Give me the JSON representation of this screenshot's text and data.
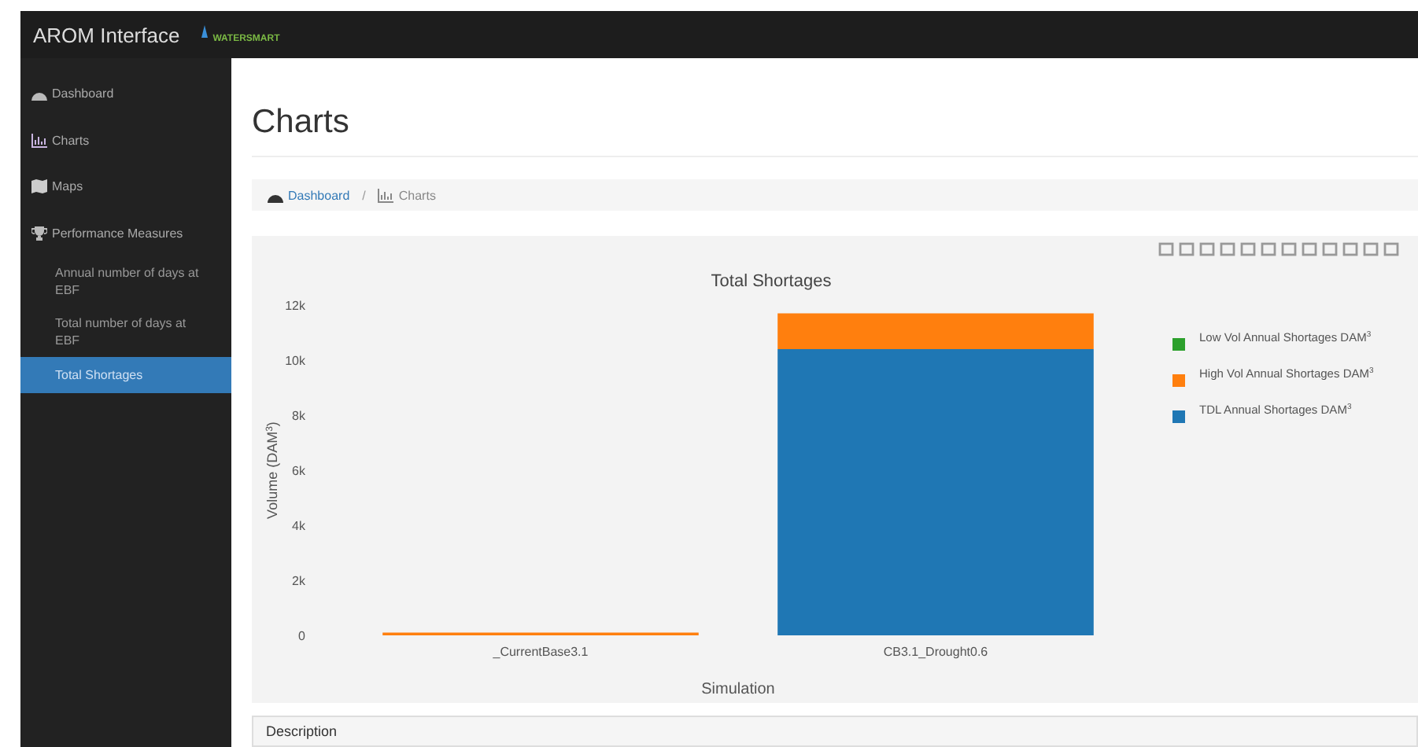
{
  "header": {
    "title": "AROM Interface",
    "logo_text": "WATERSMART"
  },
  "sidebar": {
    "items": [
      {
        "label": "Dashboard",
        "selected": false
      },
      {
        "label": "Charts",
        "selected": false
      },
      {
        "label": "Maps",
        "selected": false
      },
      {
        "label": "Performance Measures",
        "selected": false,
        "children": [
          {
            "label": "Annual number of days at EBF",
            "selected": false
          },
          {
            "label": "Total number of days at EBF",
            "selected": false
          },
          {
            "label": "Total Shortages",
            "selected": true
          }
        ]
      }
    ]
  },
  "page": {
    "title": "Charts"
  },
  "breadcrumb": {
    "separator": "/",
    "items": [
      {
        "label": "Dashboard"
      },
      {
        "label": "Charts"
      }
    ]
  },
  "chart": {
    "chart_data": {
      "type": "bar",
      "title": "Total Shortages",
      "xlabel": "Simulation",
      "ylabel": "Volume (DAM$^{3}$)",
      "stacked": true,
      "categories": [
        "_CurrentBase3.1",
        "CB3.1_Drought0.6"
      ],
      "series": [
        {
          "name": "TDL Annual Shortages DAM$^{3}$",
          "color": "#1f77b4",
          "values": [
            0,
            10400
          ]
        },
        {
          "name": "High Vol Annual Shortages DAM$^{3}$",
          "color": "#ff7f0e",
          "values": [
            100,
            1300
          ]
        },
        {
          "name": "Low Vol Annual Shortages DAM$^{3}$",
          "color": "#2ca02c",
          "values": [
            0,
            0
          ]
        }
      ],
      "legend": true,
      "ylim": [
        0,
        12000
      ],
      "yticks": [
        {
          "value": 0,
          "label": "0"
        },
        {
          "value": 2000,
          "label": "2k"
        },
        {
          "value": 4000,
          "label": "4k"
        },
        {
          "value": 6000,
          "label": "6k"
        },
        {
          "value": 8000,
          "label": "8k"
        },
        {
          "value": 10000,
          "label": "10k"
        },
        {
          "value": 12000,
          "label": "12k"
        }
      ]
    }
  },
  "description": {
    "title": "Description"
  }
}
